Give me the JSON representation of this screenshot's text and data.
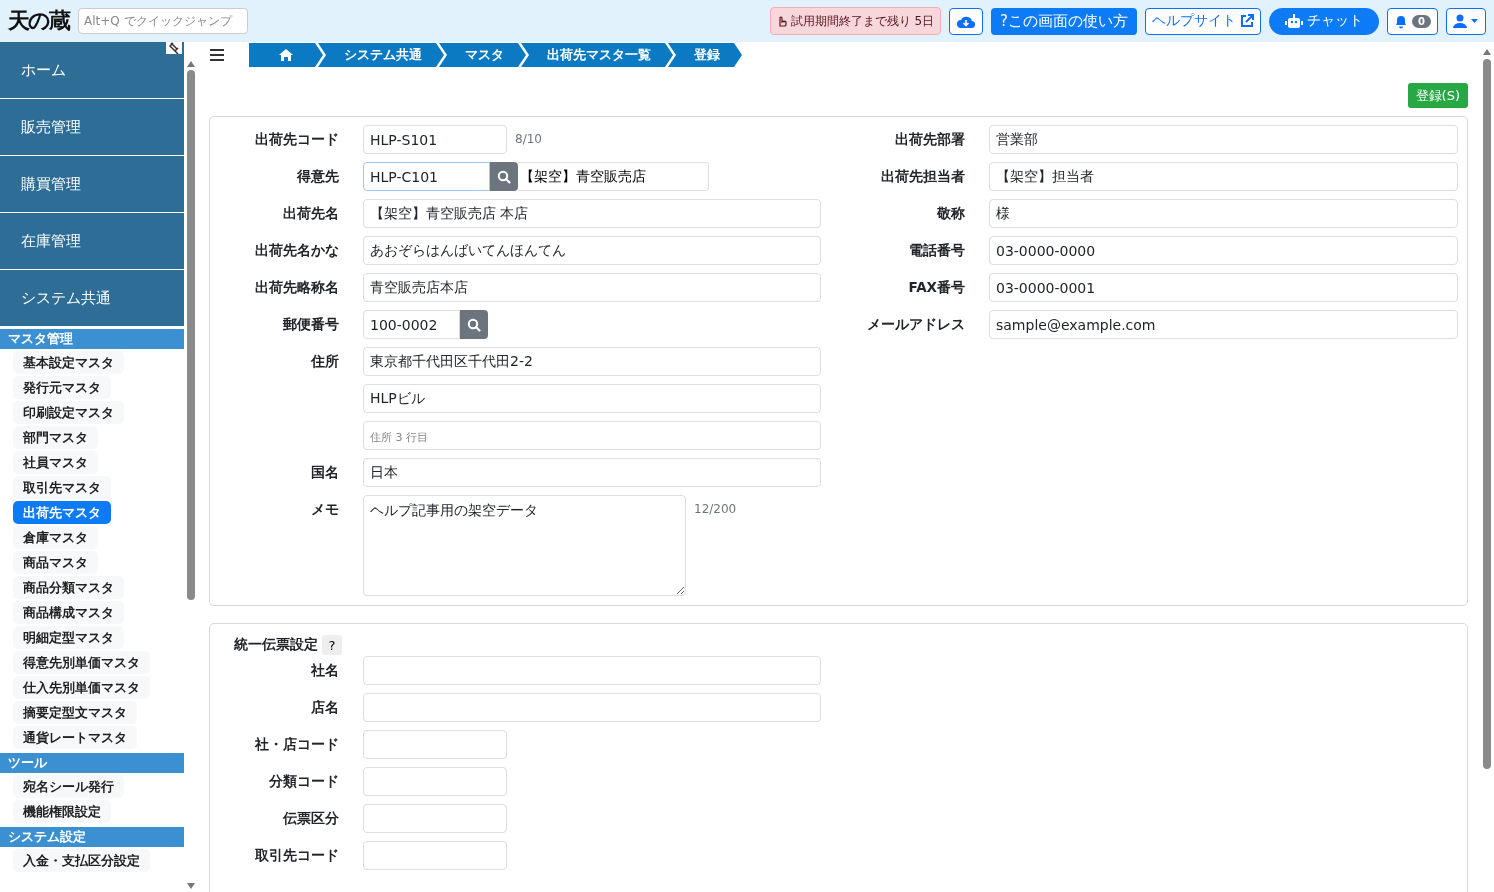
{
  "header": {
    "logo": "天の蔵",
    "quick_jump": {
      "placeholder": "Alt+Q でクイックジャンプ"
    },
    "trial_notice": "試用期間終了まで残り 5日",
    "help_button": "?この画面の使い方",
    "help_site_button": "ヘルプサイト",
    "chat_button": "チャット",
    "notification_count": "0"
  },
  "sidebar": {
    "main_items": [
      "ホーム",
      "販売管理",
      "購買管理",
      "在庫管理",
      "システム共通"
    ],
    "sections": [
      {
        "title": "マスタ管理",
        "items": [
          {
            "label": "基本設定マスタ",
            "selected": false
          },
          {
            "label": "発行元マスタ",
            "selected": false
          },
          {
            "label": "印刷設定マスタ",
            "selected": false
          },
          {
            "label": "部門マスタ",
            "selected": false
          },
          {
            "label": "社員マスタ",
            "selected": false
          },
          {
            "label": "取引先マスタ",
            "selected": false
          },
          {
            "label": "出荷先マスタ",
            "selected": true
          },
          {
            "label": "倉庫マスタ",
            "selected": false
          },
          {
            "label": "商品マスタ",
            "selected": false
          },
          {
            "label": "商品分類マスタ",
            "selected": false
          },
          {
            "label": "商品構成マスタ",
            "selected": false
          },
          {
            "label": "明細定型マスタ",
            "selected": false
          },
          {
            "label": "得意先別単価マスタ",
            "selected": false
          },
          {
            "label": "仕入先別単価マスタ",
            "selected": false
          },
          {
            "label": "摘要定型文マスタ",
            "selected": false
          },
          {
            "label": "通貨レートマスタ",
            "selected": false
          }
        ]
      },
      {
        "title": "ツール",
        "items": [
          {
            "label": "宛名シール発行",
            "selected": false
          },
          {
            "label": "機能権限設定",
            "selected": false
          }
        ]
      },
      {
        "title": "システム設定",
        "items": [
          {
            "label": "入金・支払区分設定",
            "selected": false
          }
        ]
      }
    ]
  },
  "breadcrumb": [
    "システム共通",
    "マスタ",
    "出荷先マスタ一覧",
    "登録"
  ],
  "register_button": "登録(S)",
  "main_form": {
    "left_fields": [
      {
        "kind": "short",
        "label": "出荷先コード",
        "value": "HLP-S101",
        "counter": "8/10"
      },
      {
        "kind": "lookup",
        "label": "得意先",
        "value": "HLP-C101",
        "name": "【架空】青空販売店"
      },
      {
        "kind": "text",
        "label": "出荷先名",
        "value": "【架空】青空販売店 本店"
      },
      {
        "kind": "text",
        "label": "出荷先名かな",
        "value": "あおぞらはんばいてんほんてん"
      },
      {
        "kind": "text",
        "label": "出荷先略称名",
        "value": "青空販売店本店"
      },
      {
        "kind": "search",
        "label": "郵便番号",
        "value": "100-0002"
      },
      {
        "kind": "text",
        "label": "住所",
        "value": "東京都千代田区千代田2-2"
      },
      {
        "kind": "text",
        "value": "HLPビル"
      },
      {
        "kind": "text",
        "placeholder": "住所 3 行目"
      },
      {
        "kind": "text",
        "label": "国名",
        "value": "日本"
      },
      {
        "kind": "textarea",
        "label": "メモ",
        "value": "ヘルプ記事用の架空データ",
        "counter": "12/200"
      }
    ],
    "right_fields": [
      {
        "kind": "text",
        "label": "出荷先部署",
        "value": "営業部"
      },
      {
        "kind": "text",
        "label": "出荷先担当者",
        "value": "【架空】担当者"
      },
      {
        "kind": "text",
        "label": "敬称",
        "value": "様"
      },
      {
        "kind": "text",
        "label": "電話番号",
        "value": "03-0000-0000"
      },
      {
        "kind": "text",
        "label": "FAX番号",
        "value": "03-0000-0001"
      },
      {
        "kind": "text",
        "label": "メールアドレス",
        "value": "sample@example.com"
      }
    ]
  },
  "slip_settings": {
    "title": "統一伝票設定",
    "help": "?",
    "fields": [
      {
        "kind": "text",
        "label": "社名"
      },
      {
        "kind": "text",
        "label": "店名"
      },
      {
        "kind": "short",
        "label": "社・店コード"
      },
      {
        "kind": "short",
        "label": "分類コード"
      },
      {
        "kind": "short",
        "label": "伝票区分"
      },
      {
        "kind": "short",
        "label": "取引先コード"
      }
    ]
  }
}
